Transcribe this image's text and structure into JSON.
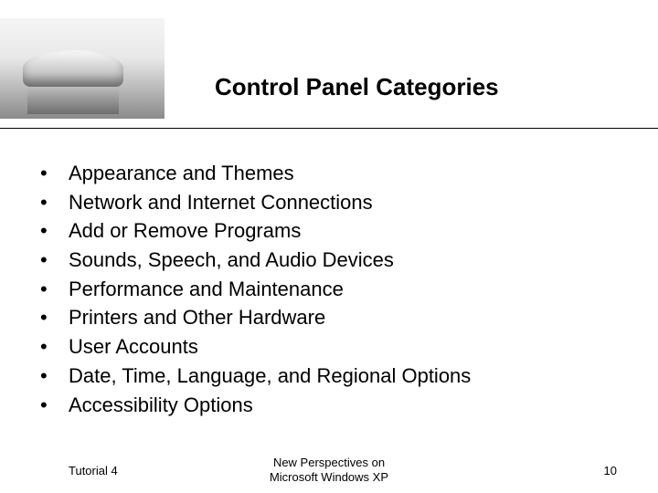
{
  "title": "Control Panel Categories",
  "bullets": [
    "Appearance and Themes",
    "Network and Internet Connections",
    "Add or Remove Programs",
    "Sounds, Speech, and Audio Devices",
    "Performance and Maintenance",
    "Printers and Other Hardware",
    "User Accounts",
    "Date, Time, Language, and Regional Options",
    "Accessibility Options"
  ],
  "footer": {
    "left": "Tutorial 4",
    "center_line1": "New Perspectives on",
    "center_line2": "Microsoft Windows XP",
    "page_number": "10"
  }
}
